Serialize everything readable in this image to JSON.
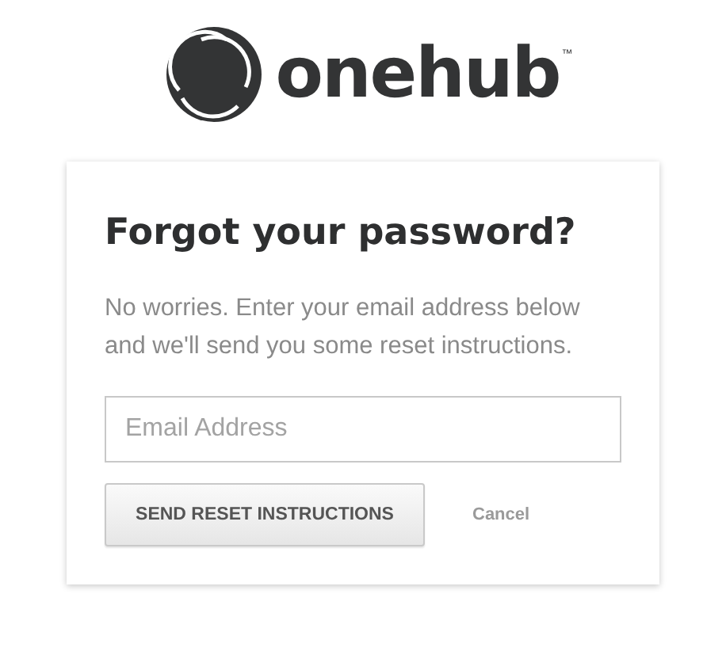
{
  "logo": {
    "wordmark": "onehub",
    "trademark": "™"
  },
  "form": {
    "title": "Forgot your password?",
    "description": "No worries. Enter your email address below and we'll send you some reset instructions.",
    "email": {
      "placeholder": "Email Address"
    },
    "submit": "SEND RESET INSTRUCTIONS",
    "cancel": "Cancel"
  }
}
